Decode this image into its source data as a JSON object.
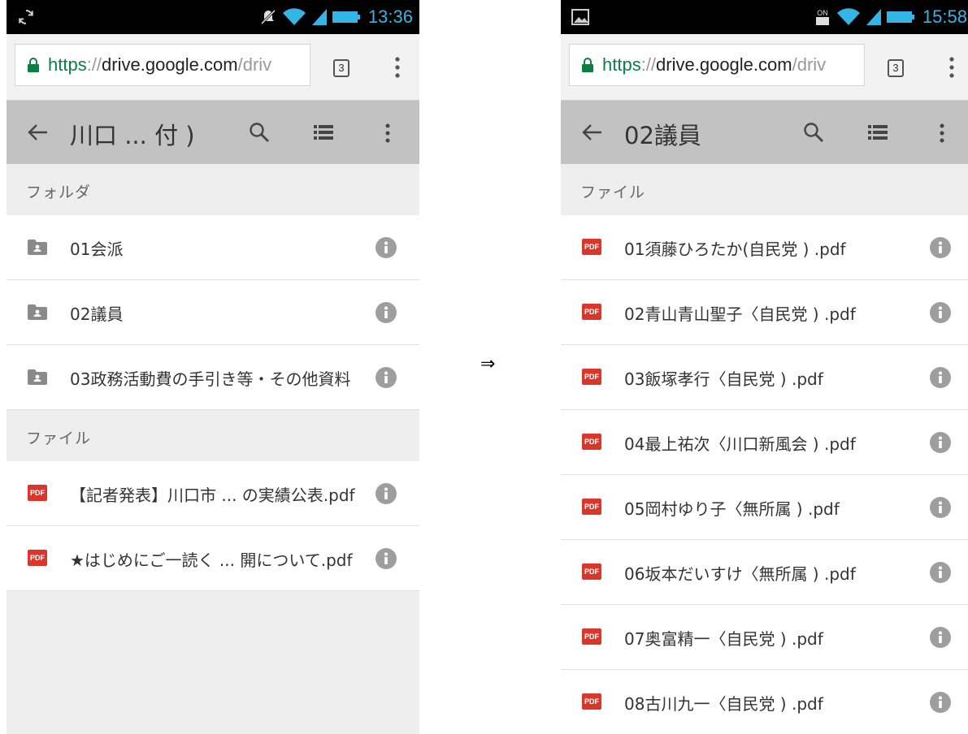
{
  "between_arrow": "⇒",
  "left": {
    "status": {
      "time": "13:36"
    },
    "browser": {
      "url_scheme": "https",
      "url_sep": "://",
      "url_host": "drive.google.com",
      "url_path": "/driv",
      "tab_count": "3"
    },
    "appbar": {
      "title": "川口 ... 付 )"
    },
    "folders_header": "フォルダ",
    "folders": [
      {
        "name": "01会派"
      },
      {
        "name": "02議員"
      },
      {
        "name": "03政務活動費の手引き等・その他資料"
      }
    ],
    "files_header": "ファイル",
    "files": [
      {
        "name": "【記者発表】川口市 ... の実績公表.pdf",
        "badge": "PDF"
      },
      {
        "name": "★はじめにご一読く ... 開について.pdf",
        "badge": "PDF"
      }
    ]
  },
  "right": {
    "status": {
      "time": "15:58"
    },
    "browser": {
      "url_scheme": "https",
      "url_sep": "://",
      "url_host": "drive.google.com",
      "url_path": "/driv",
      "tab_count": "3"
    },
    "appbar": {
      "title": "02議員"
    },
    "files_header": "ファイル",
    "files": [
      {
        "name": "01須藤ひろたか(自民党 ) .pdf",
        "badge": "PDF"
      },
      {
        "name": "02青山青山聖子〈自民党 ) .pdf",
        "badge": "PDF"
      },
      {
        "name": "03飯塚孝行〈自民党 ) .pdf",
        "badge": "PDF"
      },
      {
        "name": "04最上祐次〈川口新風会 ) .pdf",
        "badge": "PDF"
      },
      {
        "name": "05岡村ゆり子〈無所属 ) .pdf",
        "badge": "PDF"
      },
      {
        "name": "06坂本だいすけ〈無所属 ) .pdf",
        "badge": "PDF"
      },
      {
        "name": "07奥富精一〈自民党 ) .pdf",
        "badge": "PDF"
      },
      {
        "name": "08古川九一〈自民党 ) .pdf",
        "badge": "PDF"
      }
    ]
  },
  "icons": {
    "left_status_left": "sync-icon",
    "right_status_left": "image-notification-icon",
    "folder": "shared-folder-icon",
    "info": "info-icon",
    "pdf": "pdf-file-icon"
  },
  "colors": {
    "status_time": "#33b5e5",
    "appbar_bg": "#c2c2c2",
    "pdf_red": "#d9372b",
    "lock_green": "#0b8043",
    "info_gray": "#9e9e9e"
  }
}
